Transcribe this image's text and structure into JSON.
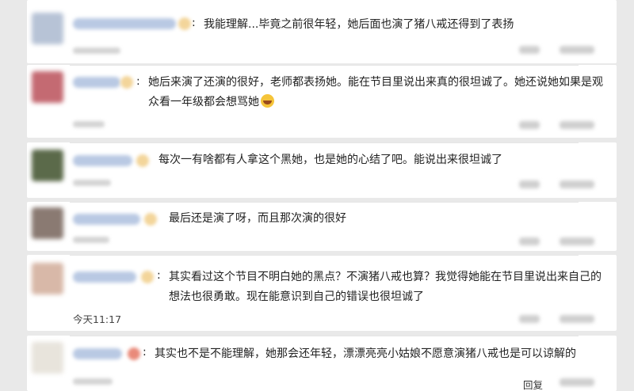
{
  "comments": [
    {
      "text": "我能理解...毕竟之前很年轻，她后面也演了猪八戒还得到了表扬",
      "colon": ":",
      "avatar_color": "#b7c3d6"
    },
    {
      "text": "她后来演了还演的很好，老师都表扬她。能在节目里说出来真的很坦诚了。她还说她如果是观众看一年级都会想骂她",
      "colon": ":",
      "avatar_color": "#c46a72",
      "emoji": "laughing-face"
    },
    {
      "text": "每次一有啥都有人拿这个黑她，也是她的心结了吧。能说出来很坦诚了",
      "avatar_color": "#5b6a4a"
    },
    {
      "text": "最后还是演了呀，而且那次演的很好",
      "avatar_color": "#8a7a72"
    },
    {
      "text": "其实看过这个节目不明白她的黑点？不演猪八戒也算？我觉得她能在节目里说出来自己的想法也很勇敢。现在能意识到自己的错误也很坦诚了",
      "colon": ":",
      "avatar_color": "#d8b8a8",
      "time": "今天11:17"
    },
    {
      "text": "其实也不是不能理解，她那会还年轻，漂漂亮亮小姑娘不愿意演猪八戒也是可以谅解的",
      "colon": ":",
      "avatar_color": "#e8e4dc",
      "reply": "回复"
    }
  ],
  "colors": {
    "username": "#b9c9e3",
    "badge": "#f3d59a",
    "text": "#222222"
  }
}
